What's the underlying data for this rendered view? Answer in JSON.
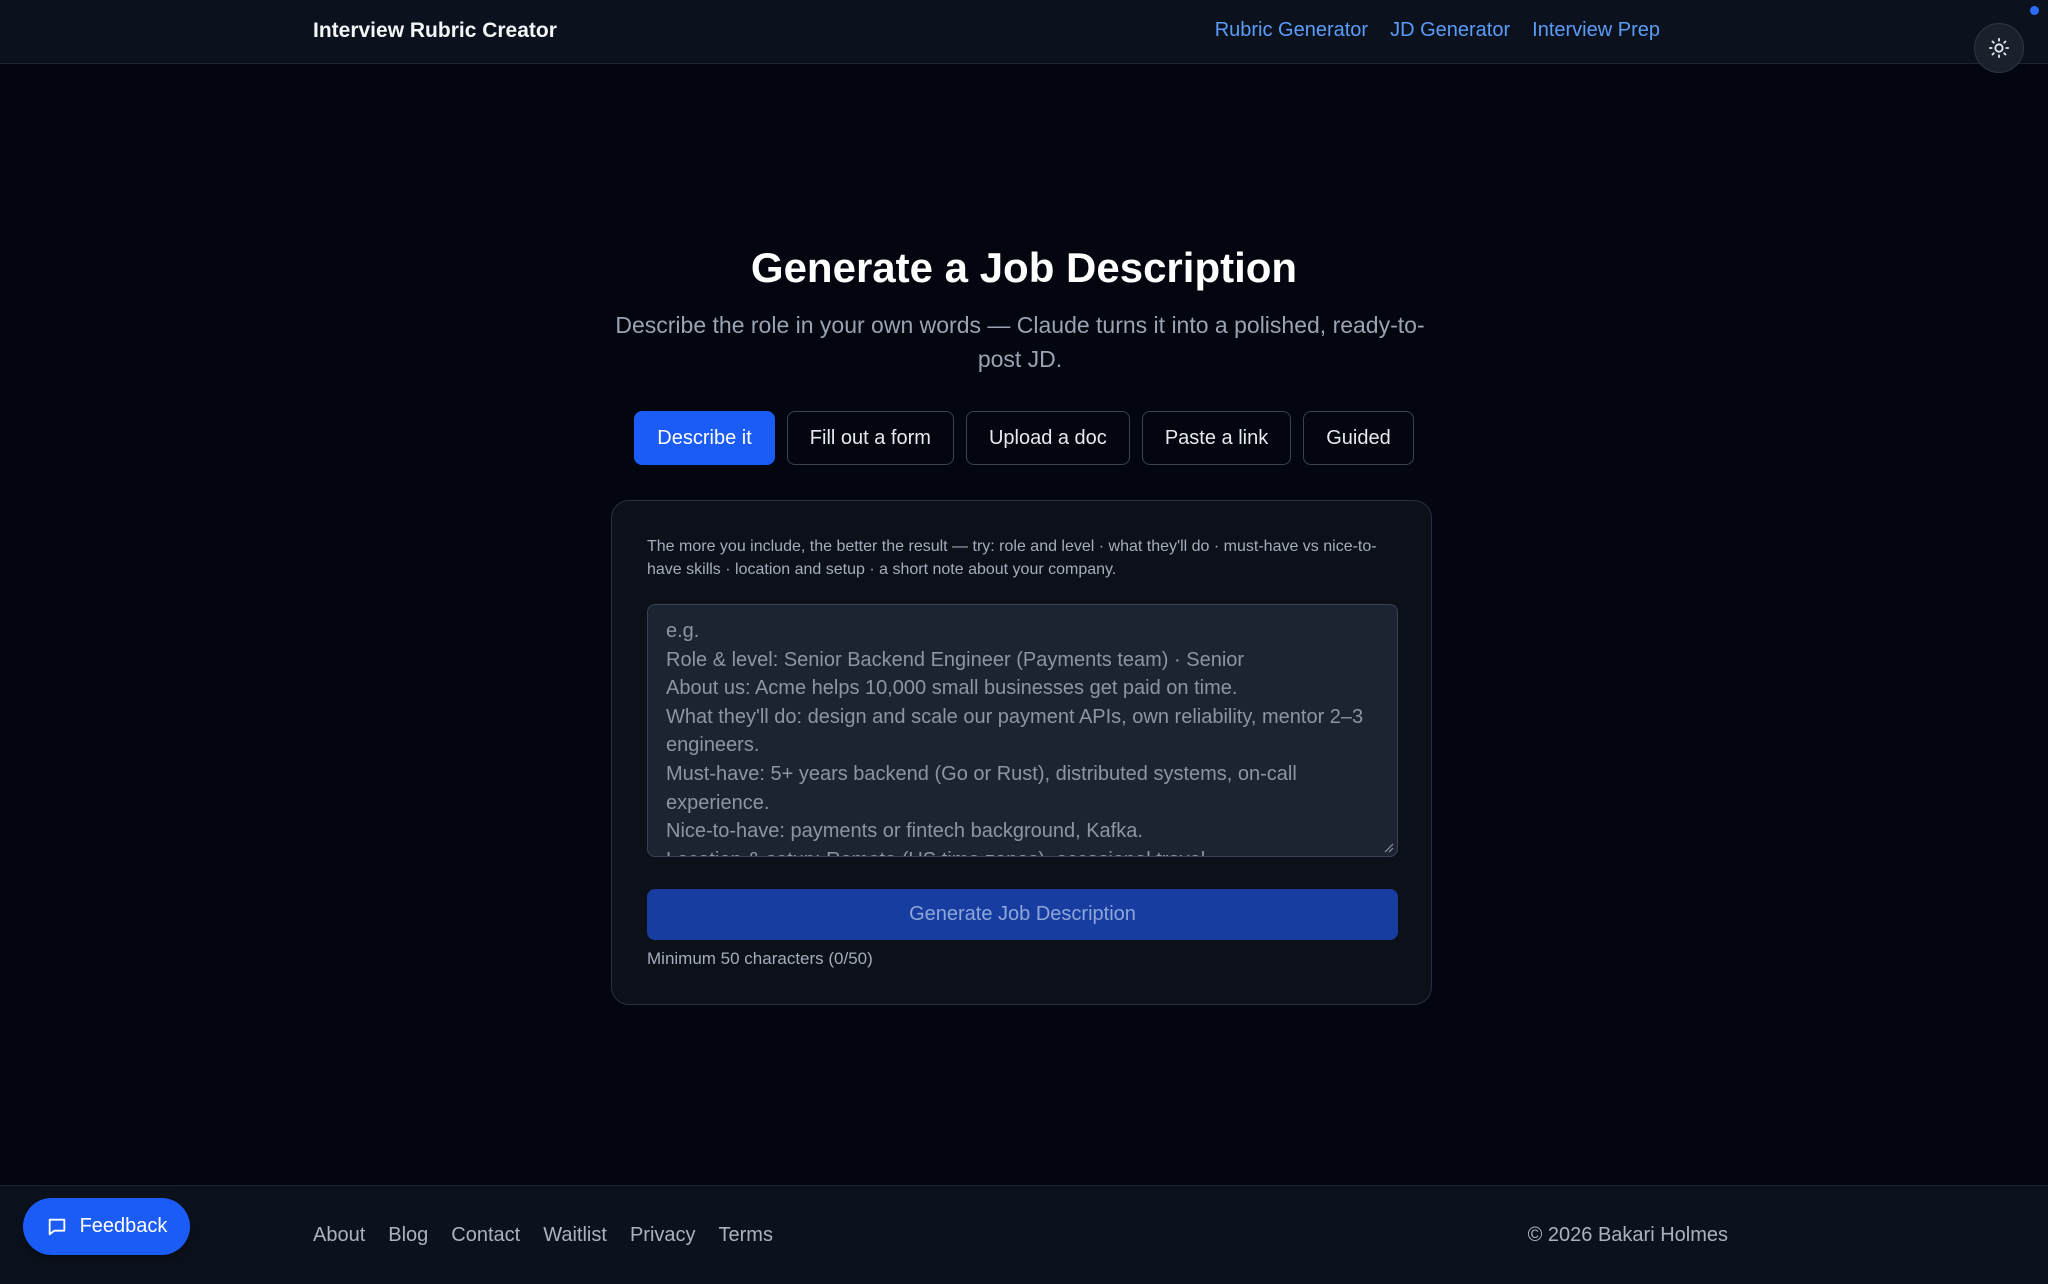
{
  "header": {
    "brand": "Interview Rubric Creator",
    "nav": [
      "Rubric Generator",
      "JD Generator",
      "Interview Prep"
    ],
    "theme_toggle_icon": "sun-icon"
  },
  "main": {
    "title": "Generate a Job Description",
    "subtitle": "Describe the role in your own words — Claude turns it into a polished, ready-to-post JD.",
    "modes": [
      {
        "label": "Describe it",
        "active": true
      },
      {
        "label": "Fill out a form",
        "active": false
      },
      {
        "label": "Upload a doc",
        "active": false
      },
      {
        "label": "Paste a link",
        "active": false
      },
      {
        "label": "Guided",
        "active": false
      }
    ],
    "card": {
      "hint": "The more you include, the better the result — try: role and level · what they'll do · must-have vs nice-to-have skills · location and setup · a short note about your company.",
      "textarea_value": "",
      "textarea_placeholder": "e.g.\nRole & level: Senior Backend Engineer (Payments team) · Senior\nAbout us: Acme helps 10,000 small businesses get paid on time.\nWhat they'll do: design and scale our payment APIs, own reliability, mentor 2–3 engineers.\nMust-have: 5+ years backend (Go or Rust), distributed systems, on-call experience.\nNice-to-have: payments or fintech background, Kafka.\nLocation & setup: Remote (US time zones), occasional travel.",
      "generate_label": "Generate Job Description",
      "min_note": "Minimum 50 characters (0/50)"
    }
  },
  "footer": {
    "links": [
      "About",
      "Blog",
      "Contact",
      "Waitlist",
      "Privacy",
      "Terms"
    ],
    "copyright": "© 2026 Bakari Holmes"
  },
  "feedback": {
    "label": "Feedback",
    "icon": "chat-bubble-icon"
  },
  "colors": {
    "accent": "#1a5cf5",
    "link": "#5b9cf8",
    "background": "#03060e"
  }
}
